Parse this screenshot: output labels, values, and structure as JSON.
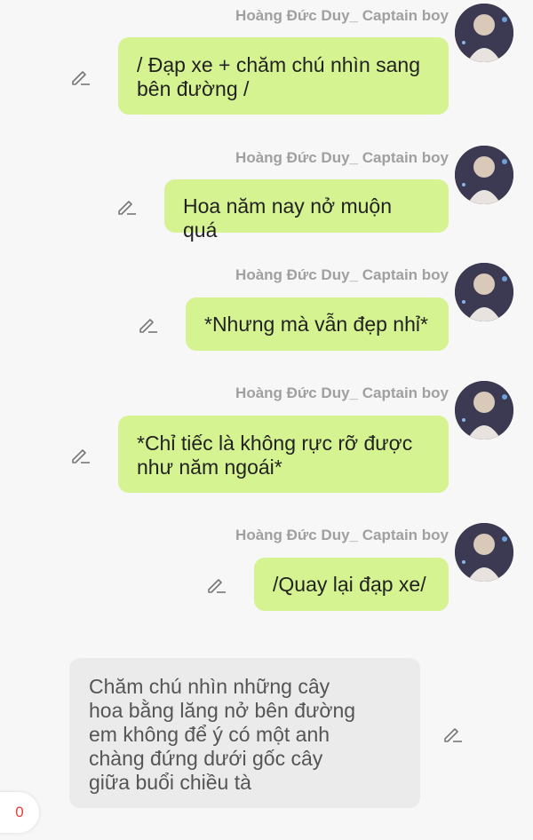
{
  "messages": [
    {
      "sender": "Hoàng Đức Duy_ Captain boy",
      "text": "/ Đạp xe + chăm chú nhìn sang bên đường /"
    },
    {
      "sender": "Hoàng Đức Duy_ Captain boy",
      "text": "Hoa năm nay nở muộn quá"
    },
    {
      "sender": "Hoàng Đức Duy_ Captain boy",
      "text": "*Nhưng mà vẫn đẹp nhỉ*"
    },
    {
      "sender": "Hoàng Đức Duy_ Captain boy",
      "text": "*Chỉ tiếc là không rực rỡ được như năm ngoái*"
    },
    {
      "sender": "Hoàng Đức Duy_ Captain boy",
      "text": "/Quay lại đạp xe/"
    },
    {
      "text": "Chăm chú nhìn những cây hoa bằng lăng nở bên đường em không để ý có một anh chàng đứng dưới gốc cây giữa buổi chiều tà"
    }
  ],
  "counter": "0",
  "icons": {
    "edit": "pencil-edit-icon",
    "avatar": "user-avatar"
  },
  "colors": {
    "outgoing_bubble": "#d6f391",
    "incoming_bubble": "#ebebeb",
    "background": "#f7f7f7",
    "sender_text": "#a0a0a0",
    "counter_text": "#e0403c"
  }
}
